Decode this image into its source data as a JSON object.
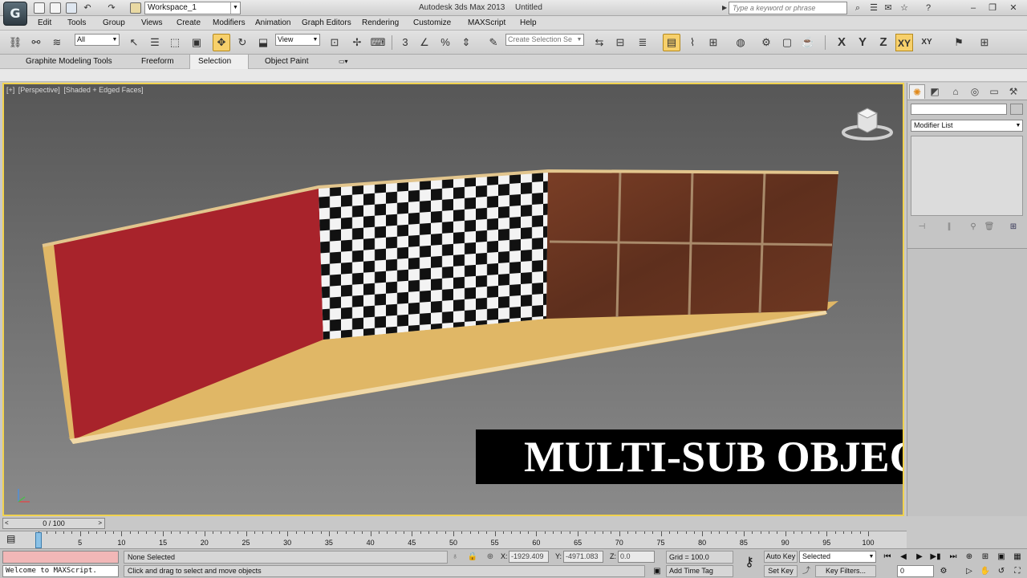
{
  "titlebar": {
    "workspace": "Workspace_1",
    "app_title": "Autodesk 3ds Max  2013",
    "doc_title": "Untitled",
    "search_placeholder": "Type a keyword or phrase",
    "icons": [
      "new-file-icon",
      "open-file-icon",
      "save-icon",
      "undo-icon",
      "redo-icon",
      "project-folder-icon",
      "binoculars-icon",
      "subscription-icon",
      "communication-icon",
      "favorites-icon",
      "help-icon",
      "minimize-icon",
      "restore-icon",
      "close-icon"
    ]
  },
  "menu": {
    "items": [
      "Edit",
      "Tools",
      "Group",
      "Views",
      "Create",
      "Modifiers",
      "Animation",
      "Graph Editors",
      "Rendering",
      "Customize",
      "MAXScript",
      "Help"
    ]
  },
  "toolbar": {
    "selection_filter": "All",
    "reference_coord": "View",
    "named_selection_placeholder": "Create Selection Se",
    "axes": [
      "X",
      "Y",
      "Z",
      "XY",
      "XY"
    ],
    "active_axis": "XY"
  },
  "ribbon": {
    "tabs": [
      "Graphite Modeling Tools",
      "Freeform",
      "Selection",
      "Object Paint"
    ],
    "active_tab": "Selection"
  },
  "viewport": {
    "label_parts": [
      "[+]",
      "[Perspective]",
      "[Shaded + Edged Faces]"
    ],
    "overlay_text": "MULTI-SUB OBJECT",
    "materials": {
      "wall_left": "#a8232b",
      "wall_mid_dark": "#111111",
      "wall_mid_light": "#f3f3f3",
      "wall_right": "#6b3520",
      "floor": "#e0b766"
    }
  },
  "command_panel": {
    "modifier_list": "Modifier List"
  },
  "timeline": {
    "slider_text": "0 / 100",
    "ticks": [
      0,
      5,
      10,
      15,
      20,
      25,
      30,
      35,
      40,
      45,
      50,
      55,
      60,
      65,
      70,
      75,
      80,
      85,
      90,
      95,
      100
    ],
    "current_frame": 0
  },
  "status": {
    "listener_text": "Welcome to MAXScript.",
    "selection": "None Selected",
    "prompt": "Click and drag to select and move objects",
    "x_label": "X:",
    "x_value": "-1929.409",
    "y_label": "Y:",
    "y_value": "-4971.083",
    "z_label": "Z:",
    "z_value": "0.0",
    "grid": "Grid = 100.0",
    "add_time_tag": "Add Time Tag",
    "auto_key": "Auto Key",
    "set_key": "Set Key",
    "key_mode": "Selected",
    "key_filters": "Key Filters...",
    "frame_value": "0"
  }
}
